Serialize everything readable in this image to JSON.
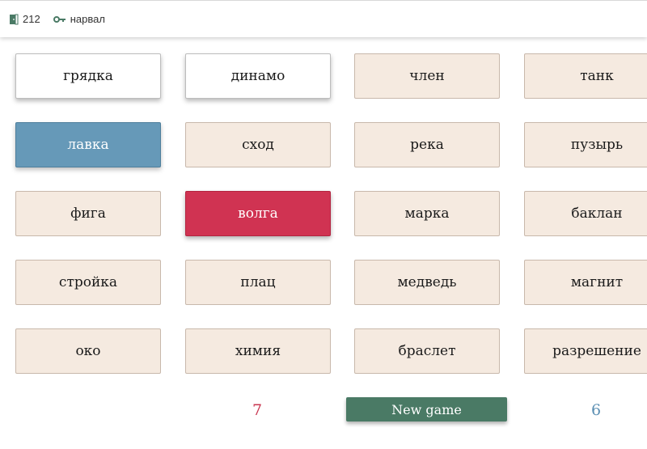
{
  "header": {
    "room_number": "212",
    "keyword": "нарвал"
  },
  "cards": [
    {
      "word": "грядка",
      "state": "neutral-revealed"
    },
    {
      "word": "динамо",
      "state": "neutral-revealed"
    },
    {
      "word": "член",
      "state": "hidden"
    },
    {
      "word": "танк",
      "state": "hidden"
    },
    {
      "word": "лавка",
      "state": "blue"
    },
    {
      "word": "сход",
      "state": "hidden"
    },
    {
      "word": "река",
      "state": "hidden"
    },
    {
      "word": "пузырь",
      "state": "hidden"
    },
    {
      "word": "фига",
      "state": "hidden"
    },
    {
      "word": "волга",
      "state": "red"
    },
    {
      "word": "марка",
      "state": "hidden"
    },
    {
      "word": "баклан",
      "state": "hidden"
    },
    {
      "word": "стройка",
      "state": "hidden"
    },
    {
      "word": "плац",
      "state": "hidden"
    },
    {
      "word": "медведь",
      "state": "hidden"
    },
    {
      "word": "магнит",
      "state": "hidden"
    },
    {
      "word": "око",
      "state": "hidden"
    },
    {
      "word": "химия",
      "state": "hidden"
    },
    {
      "word": "браслет",
      "state": "hidden"
    },
    {
      "word": "разрешение",
      "state": "hidden"
    }
  ],
  "scores": {
    "red": "7",
    "blue": "6"
  },
  "new_game_label": "New game",
  "colors": {
    "hidden_card": "#f5eae0",
    "blue_card": "#6699b8",
    "red_card": "#d03352",
    "new_game_button": "#4a7a65"
  }
}
